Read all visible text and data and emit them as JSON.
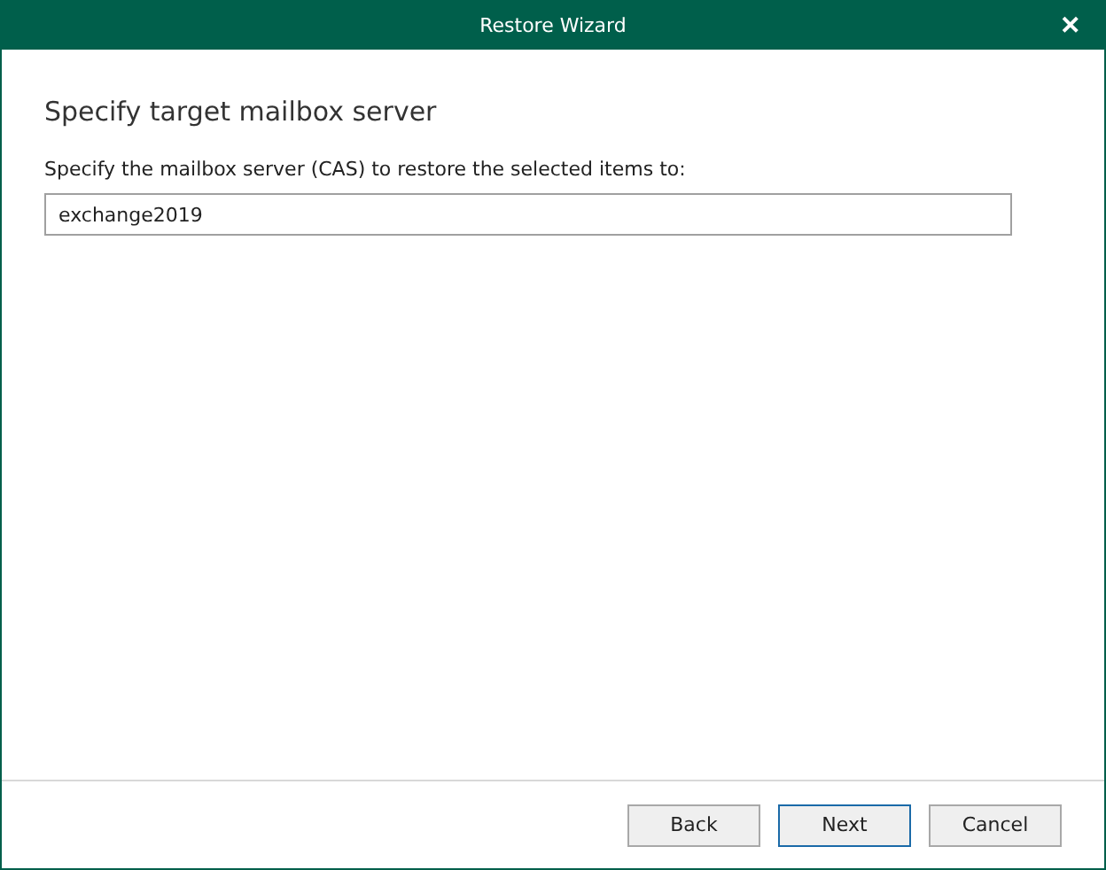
{
  "window": {
    "title": "Restore Wizard",
    "close": "✕"
  },
  "heading": "Specify target mailbox server",
  "field": {
    "label": "Specify the mailbox server (CAS) to restore the selected items to:",
    "value": "exchange2019"
  },
  "buttons": [
    {
      "label": "Back",
      "default": false
    },
    {
      "label": "Next",
      "default": true
    },
    {
      "label": "Cancel",
      "default": false
    }
  ]
}
